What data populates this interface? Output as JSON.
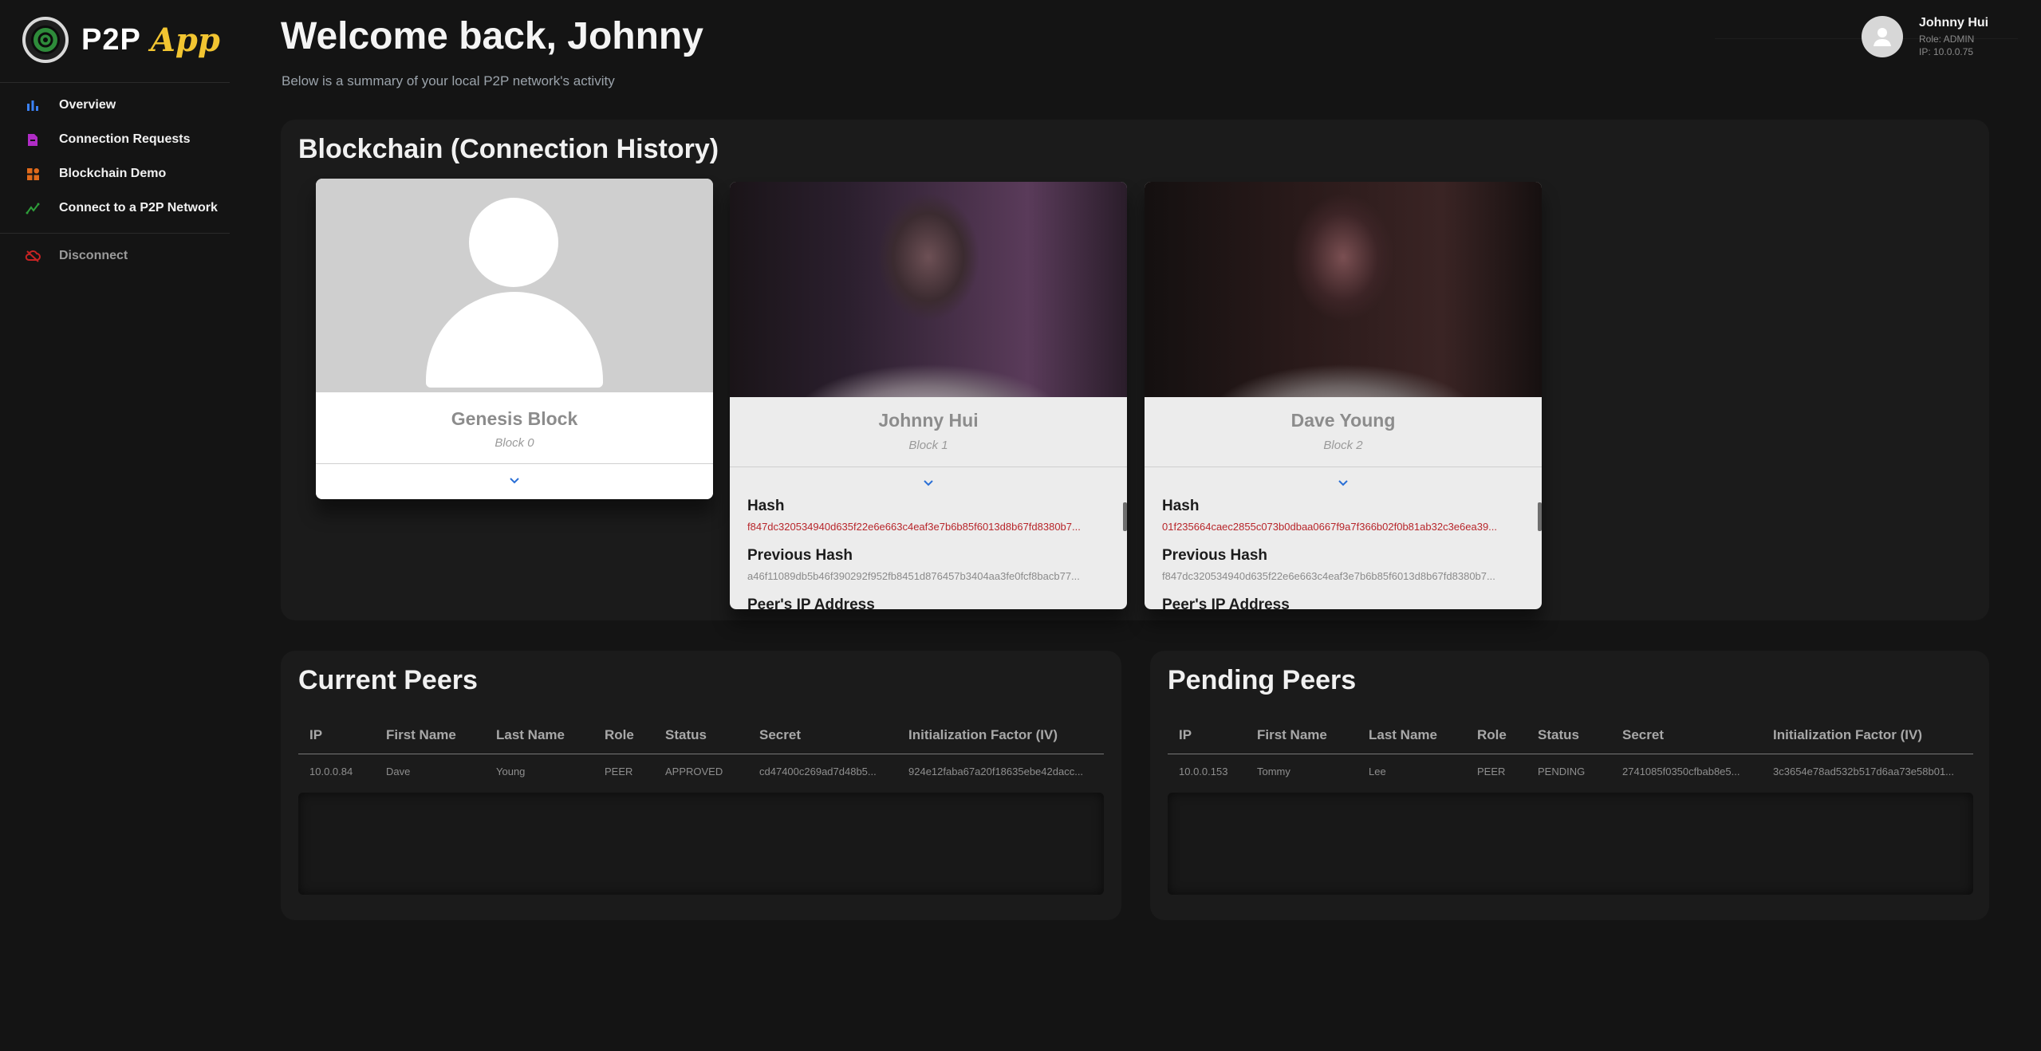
{
  "brand": {
    "name": "P2P",
    "accent": "App"
  },
  "nav": {
    "overview": "Overview",
    "connection_requests": "Connection Requests",
    "blockchain_demo": "Blockchain Demo",
    "connect": "Connect to a P2P Network",
    "disconnect": "Disconnect"
  },
  "header": {
    "title": "Welcome back, Johnny",
    "subtitle": "Below is a summary of your local P2P network's activity"
  },
  "user": {
    "name": "Johnny Hui",
    "role": "Role: ADMIN",
    "ip": "IP: 10.0.0.75"
  },
  "blockchain": {
    "title": "Blockchain (Connection History)",
    "blocks": [
      {
        "name": "Genesis Block",
        "block": "Block 0"
      },
      {
        "name": "Johnny Hui",
        "block": "Block 1",
        "hash_label": "Hash",
        "hash": "f847dc320534940d635f22e6e663c4eaf3e7b6b85f6013d8b67fd8380b7...",
        "prev_label": "Previous Hash",
        "prev_hash": "a46f11089db5b46f390292f952fb8451d876457b3404aa3fe0fcf8bacb77...",
        "ip_label": "Peer's IP Address"
      },
      {
        "name": "Dave Young",
        "block": "Block 2",
        "hash_label": "Hash",
        "hash": "01f235664caec2855c073b0dbaa0667f9a7f366b02f0b81ab32c3e6ea39...",
        "prev_label": "Previous Hash",
        "prev_hash": "f847dc320534940d635f22e6e663c4eaf3e7b6b85f6013d8b67fd8380b7...",
        "ip_label": "Peer's IP Address"
      }
    ]
  },
  "current_peers": {
    "title": "Current Peers",
    "columns": [
      "IP",
      "First Name",
      "Last Name",
      "Role",
      "Status",
      "Secret",
      "Initialization Factor (IV)"
    ],
    "rows": [
      [
        "10.0.0.84",
        "Dave",
        "Young",
        "PEER",
        "APPROVED",
        "cd47400c269ad7d48b5...",
        "924e12faba67a20f18635ebe42dacc..."
      ]
    ]
  },
  "pending_peers": {
    "title": "Pending Peers",
    "columns": [
      "IP",
      "First Name",
      "Last Name",
      "Role",
      "Status",
      "Secret",
      "Initialization Factor (IV)"
    ],
    "rows": [
      [
        "10.0.0.153",
        "Tommy",
        "Lee",
        "PEER",
        "PENDING",
        "2741085f0350cfbab8e5...",
        "3c3654e78ad532b517d6aa73e58b01..."
      ]
    ]
  },
  "colors": {
    "accent": "#f2c531",
    "hash_red": "#b8262b",
    "panel": "#1b1b1b",
    "background": "#141414"
  }
}
